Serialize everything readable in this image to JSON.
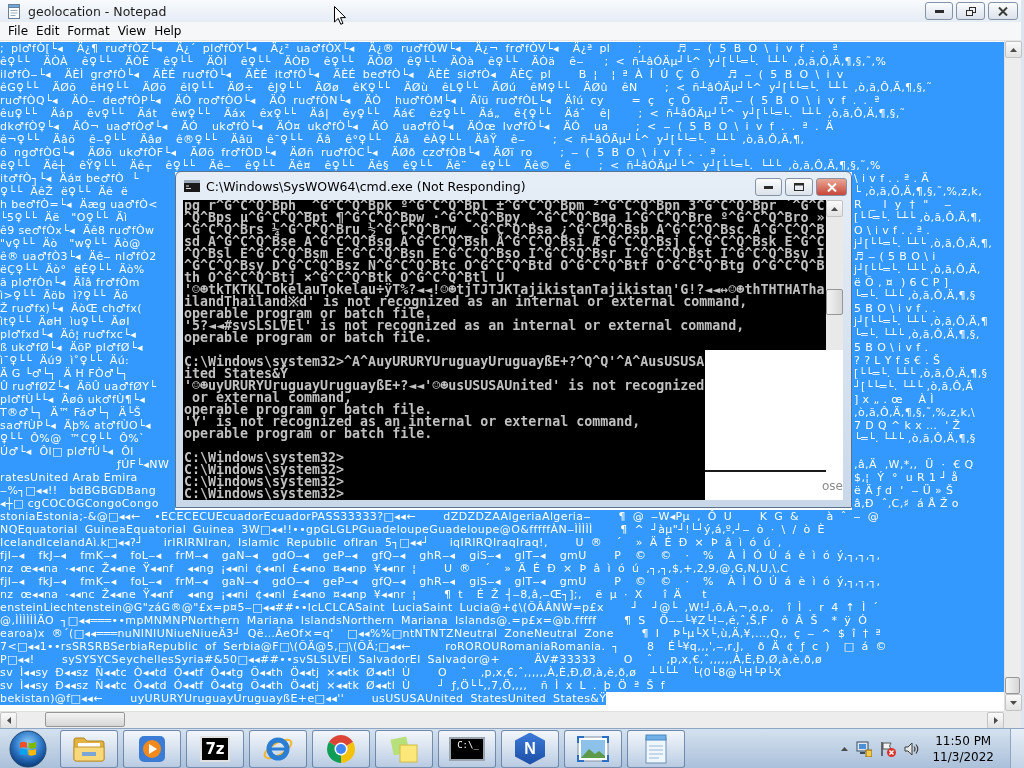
{
  "notepad": {
    "title": "geolocation - Notepad",
    "menu": [
      "File",
      "Edit",
      "Format",
      "View",
      "Help"
    ],
    "document": {
      "selected": true,
      "lines": [
        {
          "kind": "full",
          "text": "; pl♂fÒ[└◂  Ä¿¶ ru♂fÒZ└◂  Ä¿´ pl♂fÒY└◂  Ä¿² ua♂fÒX└◂  Ä¿® ru♂fÒW└◂  Ä¿¬ fr♂fÒV└◂  Ä¿ª pl    ;     ♬ ‒ ( 5 B O \\ i v f . . ª"
        },
        {
          "kind": "full",
          "text": "ê♀└└  ÄÒÀ  ê♀└└  ÄÒÈ  ê♀└└  ÄÒÌ  ê♀└└  ÄÒÐ  ê♀└└  ÄÒØ  ê♀└└  ÄÒà  ê♀└└  ÄÒä  ê‒   ; < ñ┴âÓÄµ┘└^ y┘[└└═└. └┴└ ‚ò‚ã‚Ô‚Ä‚¶‚§‚˜‚%"
        },
        {
          "kind": "full",
          "text": "il♂fÒ‒└◂  ÄÈÌ gr♂fÒ└◂  ÄÈÉ ru♂fÒ└◂  ÄÈÉ it♂fÒ└◂  ÄÈÉ be♂fÒ└◂  ÄÈÈ si♂fÒ◂  ÄÈÇ pl    B ¦  ¦ ª À Í Ú Ç Õ    ♬ ‒ ( 5 B O \\ i v"
        },
        {
          "kind": "full",
          "text": "êG♀└└  ÄØõ  êH♀└└  ÄØö  êI♀└└  ÄØ÷  êJ♀└└  ÄØø  êK♀└└  ÄØù  êL♀└└  ÄØú  êM♀└└  ÄØû  êN    ; < ñ┴âÓÄµ┘└^ y┘[└└═└. └┴└ ‚ò‚ã‚Ô‚Ä‚¶‚§‚˜"
        },
        {
          "kind": "full",
          "text": "ru♂fÒQ└◂  ÄÒ‒ de♂fÒP└◂  ÄÒ ro♂fÒO└◂  ÄÒ ru♂fÒN└◂  ÄÒ  hu♂fÒM└◂  Äîü ru♂fÒL└◂  Äîú cy    = ç  ç Õ    ♬ ‒ ( 5 B O \\ i v f . . ª"
        },
        {
          "kind": "full",
          "text": "êu♀└└  Äáp  êv♀└└  Äát  êw♀└└  Äáx  êx♀└└  Äá|  êy♀└└  Äá€  êz♀└└  Äá„  ê{♀└└  Äáˆ  ê|    ; < ñ┴âÓÄµ┘└^ y┘[└└═└. └┴└ ‚ò‚ã‚Ô‚Ä‚¶‚§‚˜"
        },
        {
          "kind": "full",
          "text": "dk♂fÒ♀└◂  ÄÓ¬ ua♂fÒ♂└◂  ÄÓ  uk♂fÒ└◂  ÄÓ¤ uk♂fÒ└◂  ÄÓ  ua♂fÒ└◂  ÄÓœ lv♂fÒ└◂  ÄÓ  ua    ; < ‒ ( 5 B O \\ i v f . . ª . Ä"
        },
        {
          "kind": "full",
          "text": "ê¬♀└└  Äâö  ê‒♀└└  Äâø  ê®♀└└  Äâü  ê¯♀└└  Äâ  ê°♀└└  Äâ  êÀ♀└└  ÄâŸ  ê‒    ; < ñ┴âÓÄµ┘└^ y┘[└└═└. └┴└ ‚ò‚ã‚Ô‚Ä‚¶‚"
        },
        {
          "kind": "full",
          "text": "õ ng♂fÒG└◂  ÄØõ uk♂fÒF└◂  ÄØõ fr♂fÒD└◂  ÄØñ ru♂fÒC└◂  ÄØð cz♂fÒB└◂  ÄØï ro    ; ‒ ( 5 B O \\ i v f . . ª ."
        },
        {
          "kind": "full",
          "text": "ê♀└└  Äê┼  êŸ♀└└  Äê┬  ê♀└└  Äê‒  ê♀└└  Äê¤  ê♀└└  Äê§  ê♀└└  Äê¨  ê♀└└  Äê©  ê    ; < ñ┴âÓÄµ┘└^ y┘[└└═└. └┴└ ‚ò‚ã‚Ô‚Ä‚¶‚§‚˜‚%"
        },
        {
          "kind": "split",
          "left": "it♂fÒ┐└◂  Äá¤ be♂fÒ  └",
          "right": "\\ i v f . . ª . Ä"
        },
        {
          "kind": "split",
          "left": "♀└└  ÄêŽ  ë♀└└  Äê  ë",
          "right": "└ ‚ò‚ã‚Ô‚Ä‚¶‚§‚˜‚%‚z‚k‚"
        },
        {
          "kind": "split",
          "left": "h be♂fÒ=└◂  Äæg ua♂fÒ<",
          "right": "R  _  l  y  †  \"    ‒"
        },
        {
          "kind": "split",
          "left": "└5♀└└  Äë   \"O♀└└  Äì",
          "right": "[└└═└. └┴└ ‚ò‚ã‚Ô‚Ä‚¶‚"
        },
        {
          "kind": "split",
          "left": "ê9 se♂fÒx└◂  Äê8 ru♂fÒw",
          "right": "O \\ i v f . . ª ."
        },
        {
          "kind": "split",
          "left": "\"v♀└└  Äò   \"w♀└└  Äò@",
          "right": "j┘[└└═└. └┴└ ‚ò‚ã‚Ô‚Ä‚¶‚"
        },
        {
          "kind": "split",
          "left": "ê® ua♂fÒ3└◂  Äê‒ nl♂fÒ2",
          "right": "♬ ‒ ( 5 B O \\ i"
        },
        {
          "kind": "split",
          "left": "ëÇ♀└└  Äò°  ëÉ♀└└  Äò%",
          "right": "j┘[└└═└. └┴└ ‚ò‚ã‚Ô‚Ä‚"
        },
        {
          "kind": "split",
          "left": "ã pl♂fÒn└◂  Äîâ fr♂fÒm",
          "right": "ë Õ ‚ ¤  ) 6 C P ]"
        },
        {
          "kind": "split",
          "left": "ì>♀└└  Äöb  ì?♀└└  Äö",
          "right": "└═└. └┴└ ‚ò‚ã‚Ô‚Ä‚¶‚§"
        },
        {
          "kind": "split",
          "left": "Ž ru♂fx)└◂  ÄòŒ ch♂fx(",
          "right": "5 B O \\ i v f . ."
        },
        {
          "kind": "split",
          "left": "ìt♀└└  ÄøH  ìu♀└└  ÄøI",
          "right": "j┘[└└═└. └┴└ ‚ò‚ã‚Ô‚Ä‚¶"
        },
        {
          "kind": "split",
          "left": "pl♂fxd└◂  Äô¦ ru♂fxc└◂",
          "right": "└═└. └┴└ ‚ò‚ã‚Ô‚Ä‚¶‚§‚"
        },
        {
          "kind": "split",
          "left": "ß uk♂fØ└◂  ÄöP pl♂fØ└◂",
          "right": "5 B O \\ i v f ."
        },
        {
          "kind": "split",
          "left": "ì¯♀└└  Äú9  ì˚♀└└  Äú:",
          "right": "? ? L Y f s € . Š"
        },
        {
          "kind": "split",
          "left": "Ä G └♂└┐  Ä H FÒ♂└┐",
          "right": "[└└═└. └┴└ ‚ò‚ã‚Ô‚Ä‚¶‚§"
        },
        {
          "kind": "split",
          "left": "Û ru♂fØZ└◂  ÄöÛ ua♂fØY└",
          "right": "┘[└└═└. └┴└ ‚ò‚ã‚Ô‚Ä"
        },
        {
          "kind": "split",
          "left": "pl♂fÙ└└◂  Äøô uk♂fÙ¶└◂",
          "right": "] x „ . œ    À Ì"
        },
        {
          "kind": "split",
          "left": "T®♂└┐  Ä™ Fá♂└┐  Ä└Š",
          "right": "‚ò‚ã‚Ô‚Ä‚¶‚§‚˜‚%‚z‚k‚\\"
        },
        {
          "kind": "split",
          "left": "sa♂fÙP└◂  Äþ% at♂fÙO└◂",
          "right": "7 D Q ^ k x …  ' Ž"
        },
        {
          "kind": "split",
          "left": "♀└└  Ô%@  ™C♀└└  Ô%`",
          "right": "└═└. └┴└ ‚ò‚ã‚Ô‚Ä‚¶‚§"
        },
        {
          "kind": "split",
          "left": "Ú♂└◂  Ôl□ pl♂fÚ└◂  Ôl"
        },
        {
          "kind": "split",
          "left": "                              ƒÚF└◂NW",
          "right": "‚â‚Ä  ‚W‚*‚‚  Ü  ·  € Q"
        },
        {
          "kind": "split",
          "left": "ratesUnited Arab Emira",
          "right": "$‚¦  Ý  °  u R 1 ┘ å"
        },
        {
          "kind": "split",
          "left": "‒%┐□◂◂!!   bdBGBGDBang",
          "right": "ë Ä ƒ d  '  ‒ Ü » Š"
        },
        {
          "kind": "split",
          "left": "◂┼□ cgCOCOGCongoCongo",
          "right": "â‚Ð  ˆ‚C‚♯  á Å Ž o"
        },
        {
          "kind": "full",
          "text": "stoniaEstonia;-&@□◂◂←  •ECECECUEcuadorEcuadorPASS33333?□◂◂←    dZDZDZAAlgeriaAlgeria‒    ¶ @ ‒W◂Pµ ‚ Ô U    K G &    à ˆ ‒ @"
        },
        {
          "kind": "full",
          "text": "NQEquatorial GuineaEquatorial Guinea 3W□◂◂!!••gpGLGLPGuadeloupeGuadeloupe@O&fffffÀN‒ÌÌÌÌÌ    ¶ ^ ┘àµ\"┘!└┘ý‚á‚º‚┘‒ ò · \\ / ò È"
        },
        {
          "kind": "full",
          "text": "IcelandIcelandAì.k□◂◂?┘   irIRIRNIran, Islamic Republic ofIran 5┐□◂◂┘   iqIRIRQIraqIraq!,    U ®  ´  » Ä É Ð × Þ â ì ó ú ‚"
        },
        {
          "kind": "full",
          "text": "fjI‒◂  fkJ‒◂  fmK‒◂  foL‒◂  frM‒◂  gaN‒◂  gdO‒◂  geP‒◂  gfQ‒◂  ghR‒◂  giS‒◂  glT‒◂  gmU    P  ©  ©  ·  %  À Ì Ó Ú á è ì ó ý‚┐‚┐‚┐‚"
        },
        {
          "kind": "full",
          "text": "nz œ◂◂na ·◂◂nc Ž◂◂ne Ÿ◂◂nf  ◂◂ng ¡◂◂ni ¢◂◂nl £◂◂no ¤◂◂np ¥◂◂nr ¦    U ®  ´  » Ä É Ð × Þ â ì ó ú ‚┐‚┐‚$‚+‚2‚9‚@‚G‚N‚U‚\\‚C"
        },
        {
          "kind": "full",
          "text": "fjI‒◂  fkJ‒◂  fmK‒◂  foL‒◂  frM‒◂  gaN‒◂  gdO‒◂  geP‒◂  gfQ‒◂  ghR‒◂  giS‒◂  glT‒◂  gmU    P  ©  ©  ·  %  À Ì Ó Ú á è ì ó ý‚┐‚┐‚┐‚"
        },
        {
          "kind": "full",
          "text": "nz œ◂◂na ·◂◂nc Ž◂◂ne Ÿ◂◂nf  ◂◂ng ¡◂◂ni ¢◂◂nl £◂◂no ¤◂◂np ¥◂◂nr ¦    ¶ t  É Ž ┤‒8‚â‚‒Œ┐];‚  ë µ · X   î Ä   t"
        },
        {
          "kind": "full",
          "text": "ensteinLiechtenstein@G\"záG®@\"£x=p¤5‒□◂◂##••lcLCLCASaint LuciaSaint Lucia@+¢\\(ÕÂÂNW=p£x    ┘  ┘@└ ‚W!┘‚õ‚À‚¬‚o‚o‚  î Ì . r 4 ↑ Ì ´"
        },
        {
          "kind": "full",
          "text": "@,ÌÌÌÌÌÌÄO ┐□◂◂═══••mpMNMNPNorthern Mariana IslandsNorthern Mariana Islands@.=p£x=@b.fffff    ¶ S  Ö‒‒└¥Z└!‒‚é‚ˆ‚Š‚F  ô Â Š  * ÿ Ó"
        },
        {
          "kind": "full",
          "text": "earoa)x ®´(□◂◂═══nuNINIUNiueNiueÄ3┘ Që…ÄeOf×=q'  □◂◂%%□ntNTNTZNeutral ZoneNeutral Zone    ¶ I  Þ└µ└X└‚ù‚Ä‚¥‚…‚Q‚‚ ç ‒ ^ $ î † ª"
        },
        {
          "kind": "full",
          "text": "7<□◂◂1••rsSRSRBSerbiaRepublic of Serbia@F□\\(ÕÄ@5‚□\\(ÕÄ;□◂◂←     roROROURomaniaRomania. ┐    8  É└¥q‚‚‚'‚‒‚r‚J‚  ð Ä ¢ ƒ c )  □ á ©"
        },
        {
          "kind": "full",
          "text": "P□◂◂!    sySYSYCSeychellesSyria#&50□◂◂##••svSLSLVEl SalvadorEl Salvador@+     ÄV#33333    O  ˆ  ‚p‚x‚€‚ˆ‚‚‚‚‚‚À‚È‚Ð‚Ø‚à‚è‚ð‚ø"
        },
        {
          "kind": "full",
          "text": "sv Ì◂◂sy Ð◂◂sz Ñ◂◂tc Ò◂◂td Ó◂◂tf Ô◂◂tg Õ◂◂th Ö◂◂tj ×◂◂tk Ø◂◂tl Ù    O  ˆ  ‚p‚x‚€‚ˆ‚‚‚‚‚‚À‚È‚Ð‚Ø‚à‚è‚ð‚ø  ┴└└┴  └(0└8@└H└P└X"
        },
        {
          "kind": "full",
          "text": "sv Ì◂◂sy Ð◂◂sz Ñ◂◂tc Ò◂◂td Ó◂◂tf Ô◂◂tg Õ◂◂th Ö◂◂tj ×◂◂tk Ø◂◂tl Ù    ┘ ƒ‚Ö└└‚‚7‚Ö‚‚‚‚  ñ Ì x L . þ Ö ª Š f"
        },
        {
          "kind": "full",
          "text": "bekistan)@f□◂◂←    uyURURYUruguayUruguayßE+e□◂◂''    usUSUSAUnited StatesUnited States&Ÿ"
        }
      ]
    }
  },
  "console_window": {
    "title": "C:\\Windows\\SysWOW64\\cmd.exe (Not Responding)",
    "lines": [
      {
        "kind": "text",
        "text": "pg r^G^C^Q^Bph _^G^C^Q^Bpk º^G^C^Q^Bpl ±^G^C^Q^Bpm ²^G^C^Q^Bpn 3^G^C^Q^Bpr ´^G^C"
      },
      {
        "kind": "text",
        "text": "^Q^Bps µ^G^C^Q^Bpt ¶^G^C^Q^Bpw ·^G^C^Q^Bpy ¸^G^C^Q^Bqa 1^G^C^Q^Bre º^G^C^Q^Bro »"
      },
      {
        "kind": "text",
        "text": "^G^C^Q^Brs ¼^G^C^Q^Bru ½^G^C^Q^Brw _^G^C^Q^Bsa ¿^G^C^Q^Bsb A^G^C^Q^Bsc A^G^C^Q^B"
      },
      {
        "kind": "text",
        "text": "sd A^G^C^Q^Bse A^G^C^Q^Bsg Ä^G^C^Q^Bsh Å^G^C^Q^Bsi Æ^G^C^Q^Bsj Ç^G^C^Q^Bsk E^G^C"
      },
      {
        "kind": "text",
        "text": "^Q^Bsl É^G^C^Q^Bsm E^G^C^Q^Bsn E^G^C^Q^Bso I^G^C^Q^Bsr I^G^C^Q^Bst I^G^C^Q^Bsv I"
      },
      {
        "kind": "text",
        "text": "^G^C^Q^Bsy D^G^C^Q^Bsz Ñ^G^C^Q^Btc O^G^C^Q^Btd O^G^C^Q^Btf O^G^C^Q^Btg O^G^C^Q^B"
      },
      {
        "kind": "text",
        "text": "th Ö^G^C^Q^Btj ×^G^C^Q^Btk O^G^C^Q^Btl U"
      },
      {
        "kind": "text",
        "text": "'☺☻tkTKTKLTokelauTokelau÷ÿT%?◄◄!☺☻tjTJTJKTajikistanTajikistan'G!?◄◄↔☺☻thTHTHATha"
      },
      {
        "kind": "text",
        "text": "ilandThailand※d' is not recognized as an internal or external command,"
      },
      {
        "kind": "text",
        "text": "operable program or batch file."
      },
      {
        "kind": "text",
        "text": "'5?◄◄#svSLSLVEl' is not recognized as an internal or external command,"
      },
      {
        "kind": "text",
        "text": "operable program or batch file."
      },
      {
        "kind": "blank"
      },
      {
        "kind": "text",
        "text": "C:\\Windows\\system32>^A^AuyURURYUruguayUruguayßE+?^Q^Q'^A^AusUSUSA"
      },
      {
        "kind": "text",
        "text": "ited States&Ÿ"
      },
      {
        "kind": "text",
        "text": "'☺☻uyURURYUruguayUruguayßE+?◄◄'☺☻usUSUSAUnited' is not recognized"
      },
      {
        "kind": "text",
        "text": " or external command,"
      },
      {
        "kind": "text",
        "text": "operable program or batch file."
      },
      {
        "kind": "text",
        "text": "'Ÿ' is not recognized as an internal or external command,"
      },
      {
        "kind": "text",
        "text": "operable program or batch file."
      },
      {
        "kind": "blank"
      },
      {
        "kind": "text",
        "text": "C:\\Windows\\system32>"
      },
      {
        "kind": "text",
        "text": "C:\\Windows\\system32>"
      },
      {
        "kind": "text",
        "text": "C:\\Windows\\system32>"
      },
      {
        "kind": "text",
        "text": "C:\\Windows\\system32>"
      }
    ],
    "overlay_fragment": {
      "text": "ose"
    }
  },
  "taskbar": {
    "apps": [
      {
        "kind": "folder"
      },
      {
        "kind": "media"
      },
      {
        "kind": "archive",
        "label": "7z"
      },
      {
        "kind": "ring-browser"
      },
      {
        "kind": "tricolor-browser"
      },
      {
        "kind": "notes"
      },
      {
        "kind": "console",
        "label": "C:\\_"
      },
      {
        "kind": "hexagon",
        "label": "N"
      },
      {
        "kind": "photo"
      },
      {
        "kind": "notepad"
      }
    ],
    "clock": {
      "time": "11:50 PM",
      "date": "11/3/2022"
    }
  }
}
